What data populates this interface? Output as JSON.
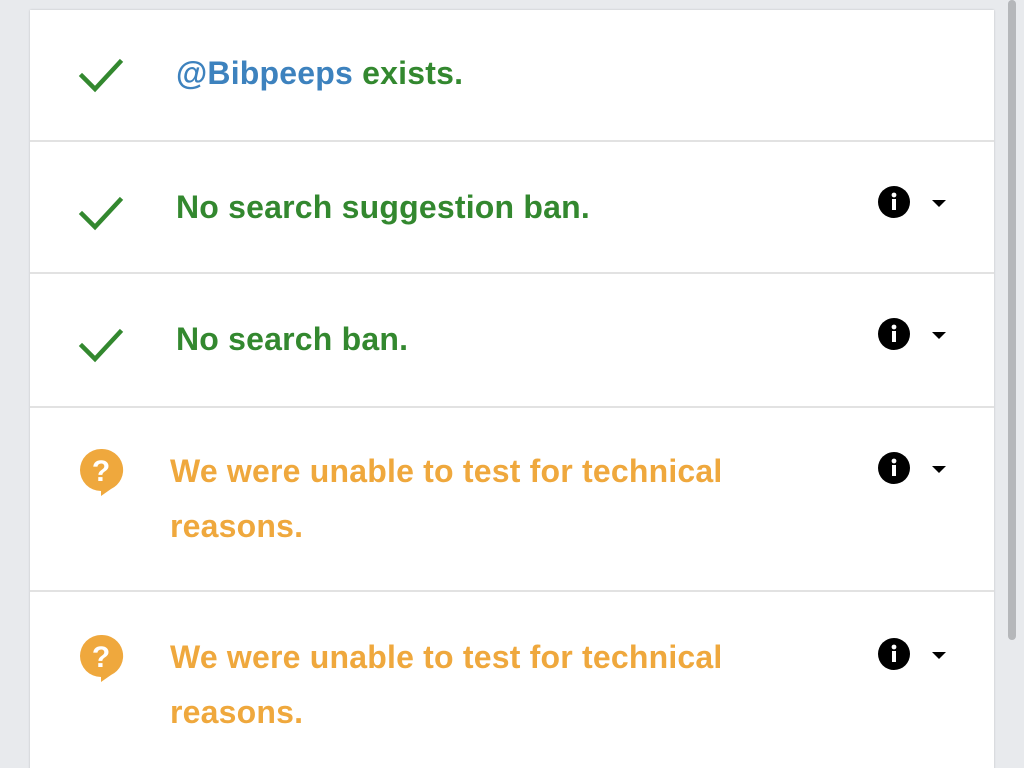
{
  "theme": {
    "success": "#33882f",
    "warning": "#efa83d",
    "link": "#3d82be"
  },
  "results": [
    {
      "status": "success",
      "icon": "check-icon",
      "handle": "@Bibpeeps",
      "text": " exists.",
      "has_details": false
    },
    {
      "status": "success",
      "icon": "check-icon",
      "text": "No search suggestion ban.",
      "has_details": true,
      "details_icon": "info-icon",
      "toggle_icon": "caret-down-icon"
    },
    {
      "status": "success",
      "icon": "check-icon",
      "text": "No search ban.",
      "has_details": true,
      "details_icon": "info-icon",
      "toggle_icon": "caret-down-icon"
    },
    {
      "status": "warning",
      "icon": "question-bubble-icon",
      "text": "We were unable to test for technical reasons.",
      "has_details": true,
      "details_icon": "info-icon",
      "toggle_icon": "caret-down-icon"
    },
    {
      "status": "warning",
      "icon": "question-bubble-icon",
      "text": "We were unable to test for technical reasons.",
      "has_details": true,
      "details_icon": "info-icon",
      "toggle_icon": "caret-down-icon"
    }
  ]
}
